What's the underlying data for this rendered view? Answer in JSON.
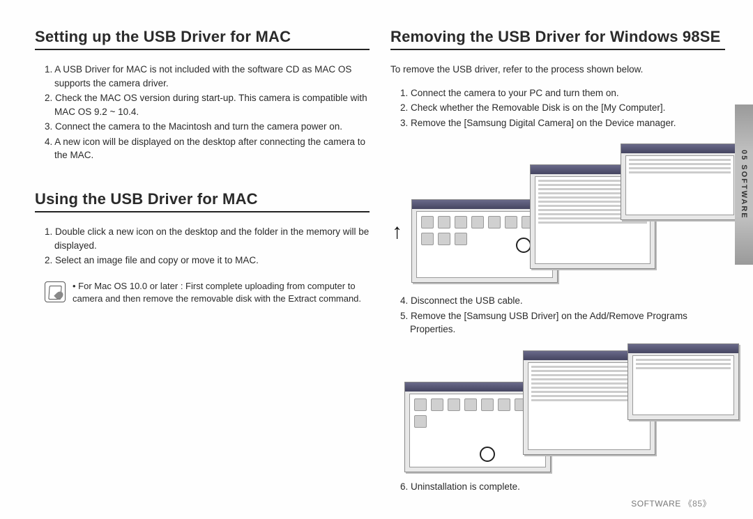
{
  "left": {
    "heading1": "Setting up the USB Driver for MAC",
    "list1": [
      "1. A USB Driver for MAC is not included with the software CD as MAC OS supports the camera driver.",
      "2. Check the MAC OS version during start-up. This camera is compatible with MAC OS 9.2 ~ 10.4.",
      "3. Connect the camera to the Macintosh and turn the camera power on.",
      "4. A new icon will be displayed on the desktop after connecting the camera to the MAC."
    ],
    "heading2": "Using the USB Driver for MAC",
    "list2": [
      "1. Double click a new icon on the desktop and the folder in the memory will be displayed.",
      "2. Select an image file and copy or move it to MAC."
    ],
    "note": "• For Mac OS 10.0 or later : First complete uploading from computer to camera and then remove the removable disk with the Extract command."
  },
  "right": {
    "heading": "Removing the USB Driver for Windows 98SE",
    "intro": "To remove the USB driver, refer to the process shown below.",
    "listA": [
      "1. Connect the camera to your PC and turn them on.",
      "2. Check whether the Removable Disk is on the [My Computer].",
      "3. Remove the [Samsung Digital Camera] on the Device manager."
    ],
    "listB": [
      "4. Disconnect the USB cable.",
      "5. Remove the [Samsung USB Driver] on the Add/Remove Programs Properties."
    ],
    "listC": [
      "6. Uninstallation is complete."
    ]
  },
  "sideTab": "05 SOFTWARE",
  "footer_label": "SOFTWARE",
  "footer_page": "《85》"
}
